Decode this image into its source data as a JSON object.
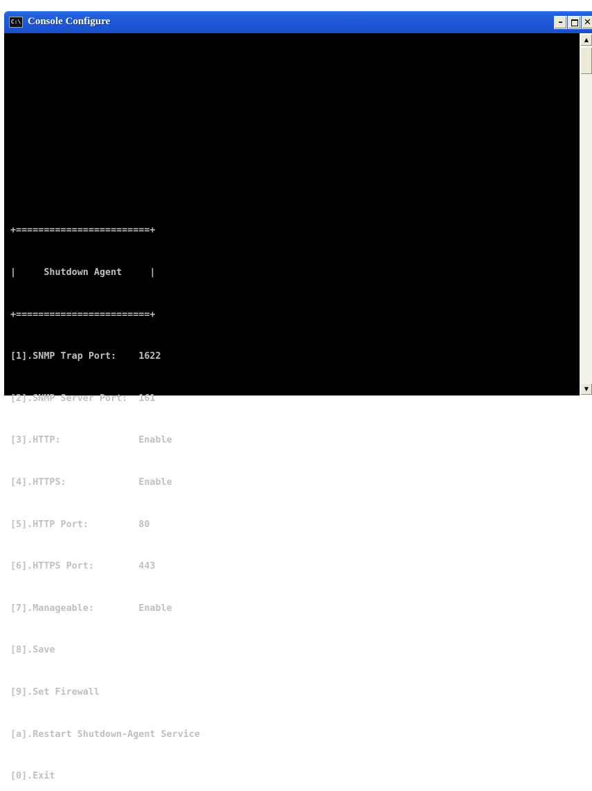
{
  "window": {
    "title": "Console Configure",
    "icon_label": "C:\\",
    "buttons": {
      "minimize_icon": "minimize-icon",
      "maximize_icon": "maximize-icon",
      "close_icon": "close-icon"
    }
  },
  "console": {
    "lines": [
      "+========================+",
      "|     Shutdown Agent     |",
      "+========================+",
      "[1].SNMP Trap Port:    1622",
      "[2].SNMP Server Port:  161",
      "[3].HTTP:              Enable",
      "[4].HTTPS:             Enable",
      "[5].HTTP Port:         80",
      "[6].HTTPS Port:        443",
      "[7].Manageable:        Enable",
      "[8].Save",
      "[9].Set Firewall",
      "[a].Restart Shutdown-Agent Service",
      "[0].Exit"
    ]
  },
  "colors": {
    "console_bg": "#000000",
    "console_fg": "#c0c0c0",
    "titlebar": "#1e56d6"
  }
}
